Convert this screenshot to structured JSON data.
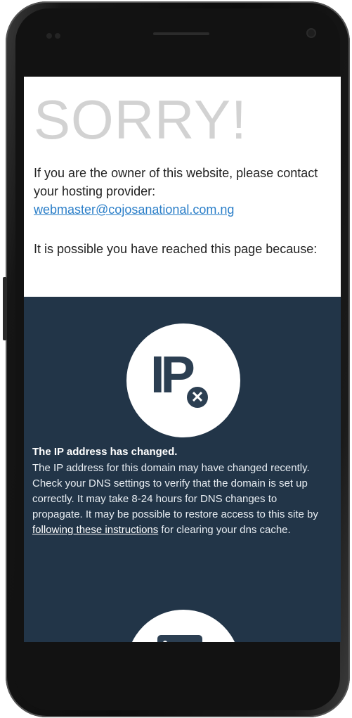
{
  "page": {
    "heading": "SORRY!",
    "intro_text": "If you are the owner of this website, please contact your hosting provider:",
    "contact_email": "webmaster@cojosanational.com.ng",
    "reason_intro": "It is possible you have reached this page because:"
  },
  "reasons": [
    {
      "icon": "ip-address-icon",
      "icon_text": "IP",
      "title": "The IP address has changed.",
      "body_before_link": "The IP address for this domain may have changed recently. Check your DNS settings to verify that the domain is set up correctly. It may take 8-24 hours for DNS changes to propagate. It may be possible to restore access to this site by ",
      "link_text": "following these instructions",
      "body_after_link": " for clearing your dns cache."
    },
    {
      "icon": "server-icon"
    }
  ],
  "colors": {
    "dark_panel": "#223548",
    "icon_fg": "#2c3f52",
    "link": "#2a7ec8",
    "heading": "#d2d2d2"
  }
}
